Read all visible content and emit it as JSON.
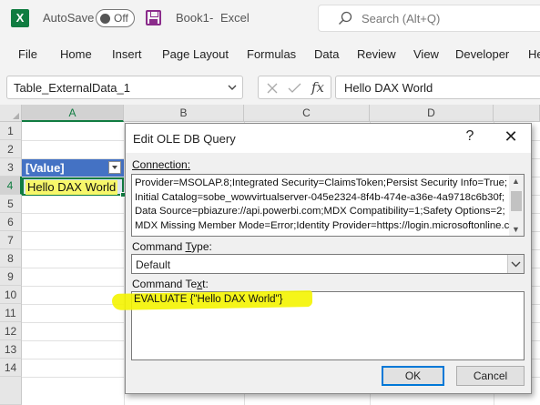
{
  "titlebar": {
    "app_icon": "X",
    "autosave_label": "AutoSave",
    "autosave_state": "Off",
    "document": "Book1",
    "separator": "-",
    "app_name": "Excel",
    "search_placeholder": "Search (Alt+Q)"
  },
  "menu": [
    "File",
    "Home",
    "Insert",
    "Page Layout",
    "Formulas",
    "Data",
    "Review",
    "View",
    "Developer",
    "He"
  ],
  "formula_bar": {
    "name_box": "Table_ExternalData_1",
    "fx": "fx",
    "formula": "Hello DAX World"
  },
  "grid": {
    "columns": [
      "A",
      "B",
      "C",
      "D"
    ],
    "rows": [
      "1",
      "2",
      "3",
      "4",
      "5",
      "6",
      "7",
      "8",
      "9",
      "10",
      "11",
      "12",
      "13",
      "14"
    ],
    "table_header": "[Value]",
    "cell_a4": "Hello DAX World"
  },
  "dialog": {
    "title": "Edit OLE DB Query",
    "help": "?",
    "close": "✕",
    "connection_label": "Connection:",
    "connection_text": "Provider=MSOLAP.8;Integrated Security=ClaimsToken;Persist Security Info=True;Initial Catalog=sobe_wowvirtualserver-045e2324-8f4b-474e-a36e-4a9718c6b30f;Data Source=pbiazure://api.powerbi.com;MDX Compatibility=1;Safety Options=2;MDX Missing Member Mode=Error;Identity Provider=https://login.microsoftonline.com/common,",
    "command_type_label_pre": "Command ",
    "command_type_label_key": "T",
    "command_type_label_post": "ype:",
    "command_type_value": "Default",
    "command_text_label_pre": "Command Te",
    "command_text_label_key": "x",
    "command_text_label_post": "t:",
    "command_text": "EVALUATE {\"Hello DAX World\"}",
    "ok": "OK",
    "cancel": "Cancel"
  }
}
